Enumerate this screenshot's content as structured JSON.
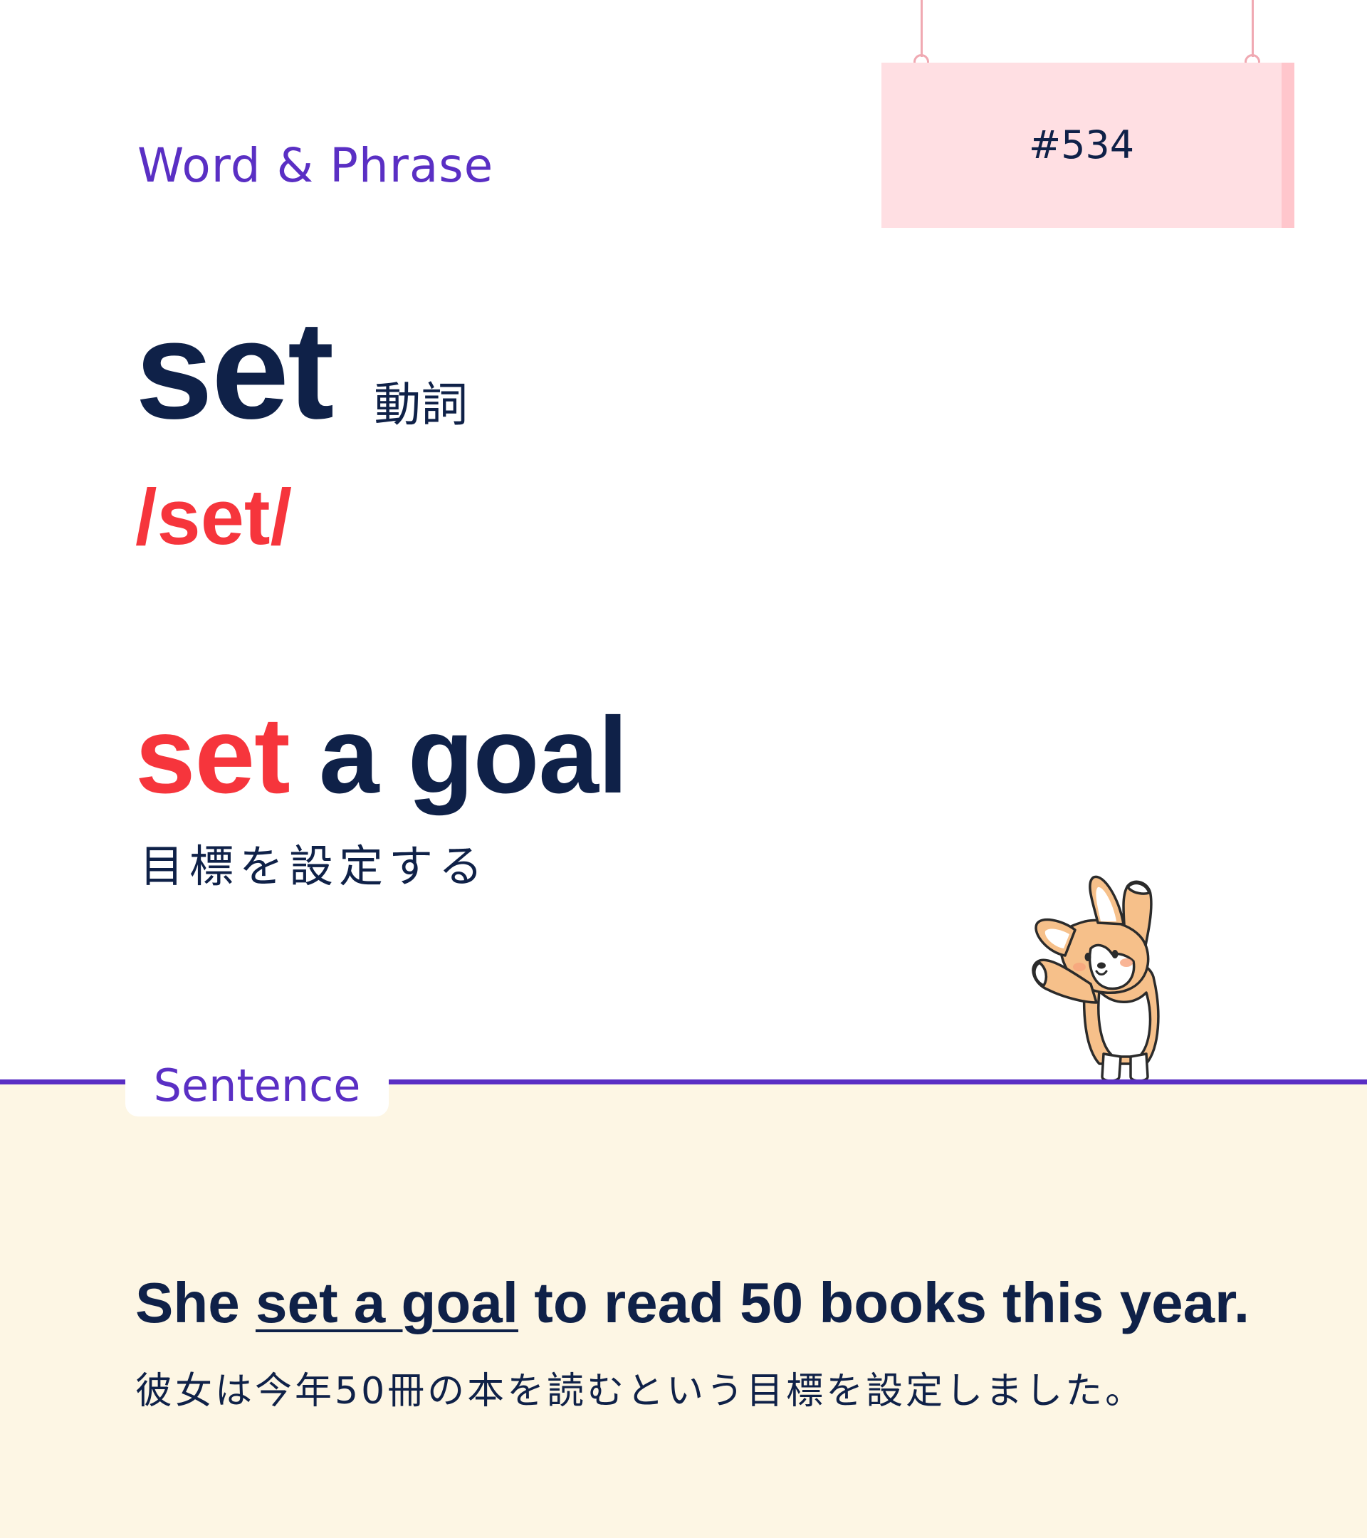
{
  "header": {
    "category": "Word & Phrase",
    "number_label": "#534"
  },
  "word": {
    "headword": "set",
    "part_of_speech": "動詞",
    "pronunciation": "/set/"
  },
  "phrase": {
    "highlight": "set",
    "rest": " a goal",
    "translation": "目標を設定する"
  },
  "sentence_section": {
    "label": "Sentence",
    "sentence_before": "She ",
    "sentence_underlined": "set a goal",
    "sentence_after": " to read 50 books this year.",
    "translation": "彼女は今年50冊の本を読むという目標を設定しました。"
  },
  "colors": {
    "accent_purple": "#5a2fc4",
    "highlight_red": "#f6353c",
    "text_navy": "#0f2148",
    "sign_pink": "#ffdfe3",
    "panel_cream": "#fdf6e4"
  },
  "icons": {
    "mascot": "corgi-stretching-icon"
  }
}
